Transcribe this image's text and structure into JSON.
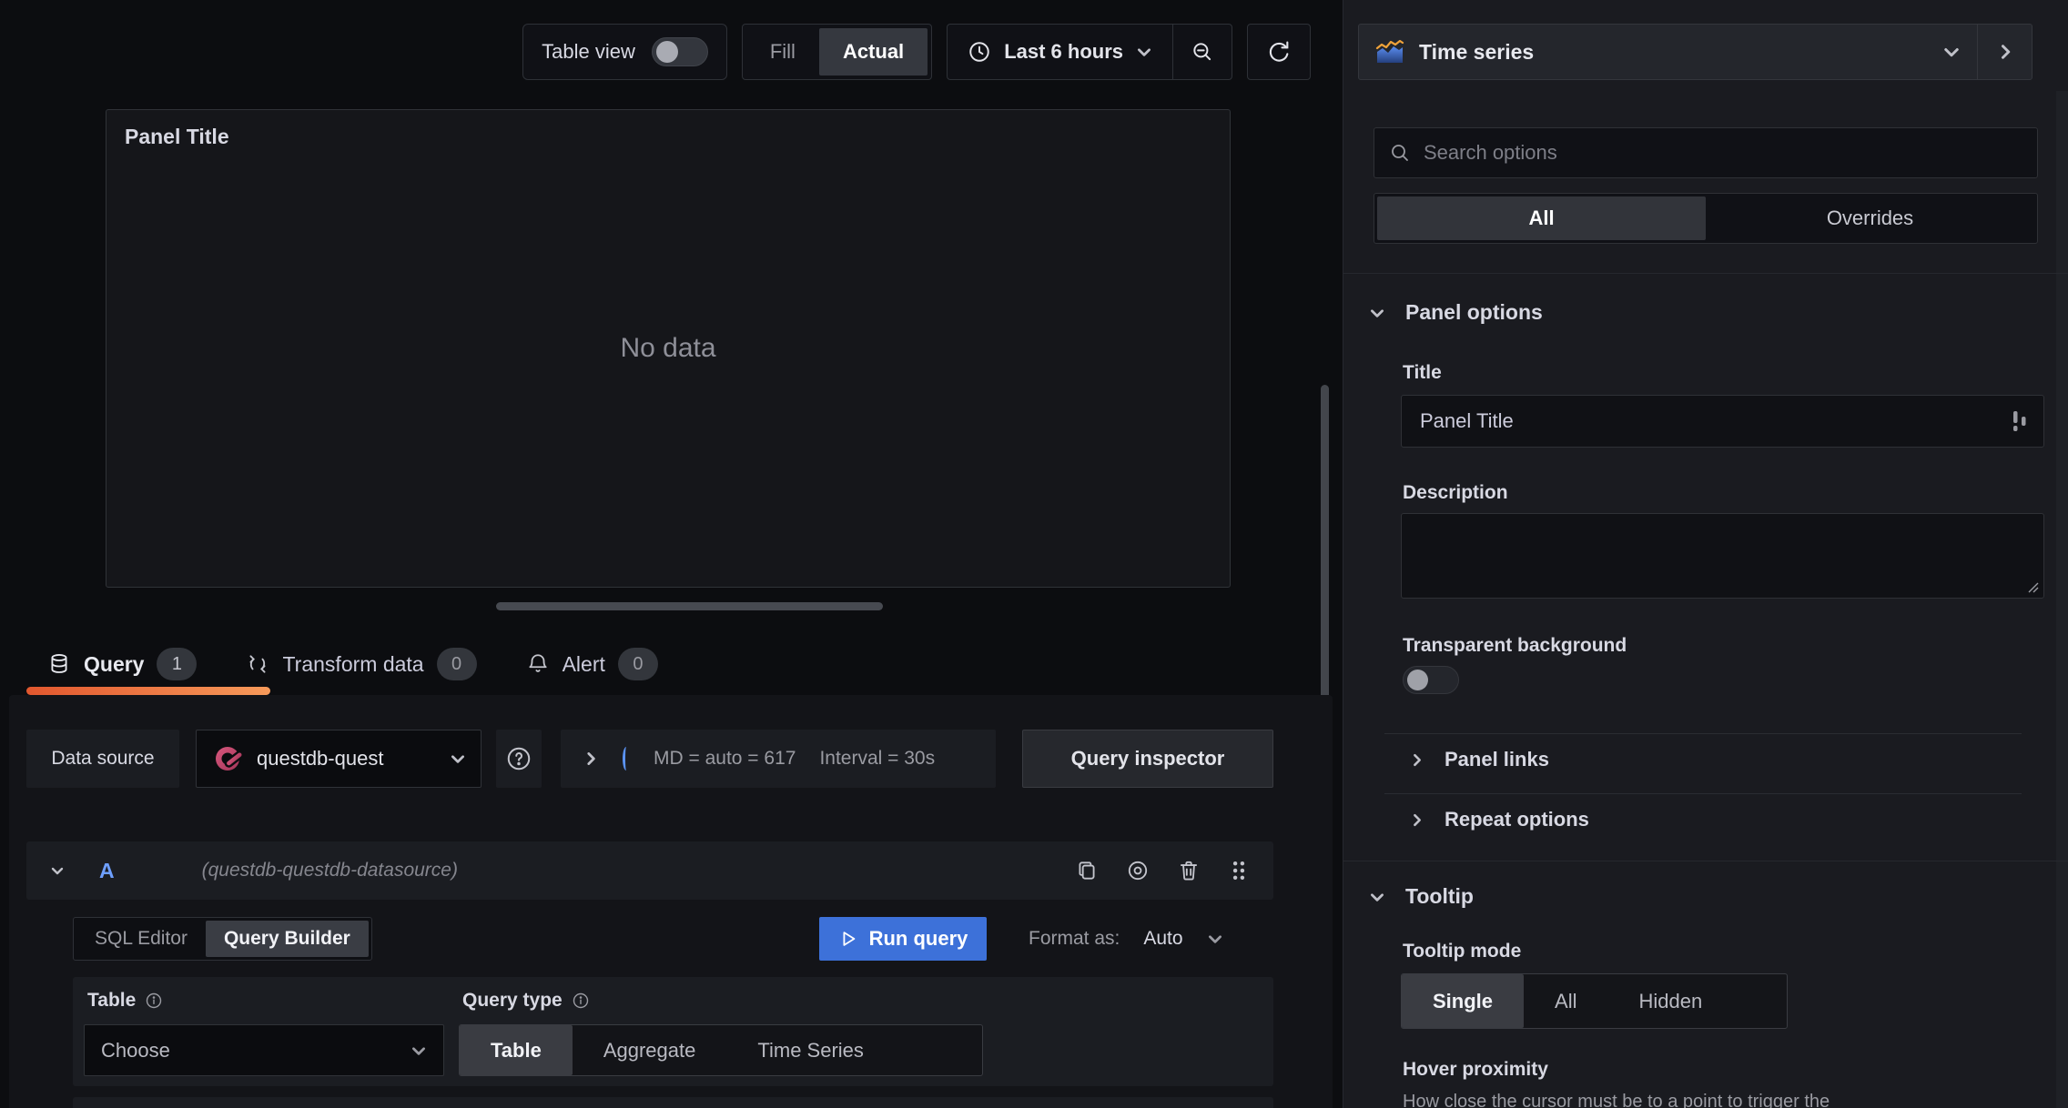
{
  "toolbar": {
    "table_view_label": "Table view",
    "display_modes": {
      "fill": "Fill",
      "actual": "Actual",
      "selected": "Actual"
    },
    "time_range": "Last 6 hours"
  },
  "main": {
    "panel": {
      "title": "Panel Title",
      "no_data": "No data"
    },
    "tabs": [
      {
        "label": "Query",
        "count": "1"
      },
      {
        "label": "Transform data",
        "count": "0"
      },
      {
        "label": "Alert",
        "count": "0"
      }
    ],
    "active_tab": "Query",
    "datasource_row": {
      "label": "Data source",
      "datasource": "questdb-quest",
      "max_data_points": "MD = auto = 617",
      "interval": "Interval = 30s",
      "inspector": "Query inspector"
    },
    "query": {
      "ref": "A",
      "datasource_hint": "(questdb-questdb-datasource)",
      "editor_modes": [
        {
          "label": "SQL Editor"
        },
        {
          "label": "Query Builder"
        }
      ],
      "editor_mode_selected": "Query Builder",
      "run_label": "Run query",
      "format_label": "Format as:",
      "format_value": "Auto",
      "builder": {
        "table_label": "Table",
        "table_value": "Choose",
        "query_type_label": "Query type",
        "query_types": [
          {
            "label": "Table"
          },
          {
            "label": "Aggregate"
          },
          {
            "label": "Time Series"
          }
        ],
        "query_type_selected": "Table"
      }
    }
  },
  "sidebar": {
    "visualization": "Time series",
    "search_placeholder": "Search options",
    "tabs": [
      {
        "label": "All"
      },
      {
        "label": "Overrides"
      }
    ],
    "active_tab": "All",
    "panel_options": {
      "heading": "Panel options",
      "title_label": "Title",
      "title_value": "Panel Title",
      "description_label": "Description",
      "transparent_label": "Transparent background",
      "panel_links": "Panel links",
      "repeat_options": "Repeat options"
    },
    "tooltip": {
      "heading": "Tooltip",
      "mode_label": "Tooltip mode",
      "modes": [
        {
          "label": "Single"
        },
        {
          "label": "All"
        },
        {
          "label": "Hidden"
        }
      ],
      "mode_selected": "Single",
      "hover_label": "Hover proximity",
      "hover_description": "How close the cursor must be to a point to trigger the"
    }
  },
  "colors": {
    "accent_blue": "#3D71D9",
    "link_blue": "#6E9FFF",
    "tab_active_gradient_start": "#E2572E",
    "tab_active_gradient_end": "#F79A5A",
    "questdb_pink": "#C9476F"
  },
  "icons": {
    "toggle": "switch-off",
    "clock": "clock-circle",
    "chevron_down": "⌄",
    "chevron_right": "›",
    "zoom_out": "magnifier-minus",
    "refresh": "circular-arrow",
    "time_series": "area-chart-orange-line",
    "search": "magnifier",
    "database": "db-cylinder",
    "transform": "cycle-arrows",
    "alert": "bell",
    "help": "question-circle",
    "info": "info-circle",
    "copy": "duplicate-sheets",
    "eye": "concentric-circles",
    "trash": "bin",
    "drag": "grip-dots",
    "play": "triangle-outline",
    "variable_suggestion": "vertical-bars",
    "resize": "diagonal-lines"
  }
}
